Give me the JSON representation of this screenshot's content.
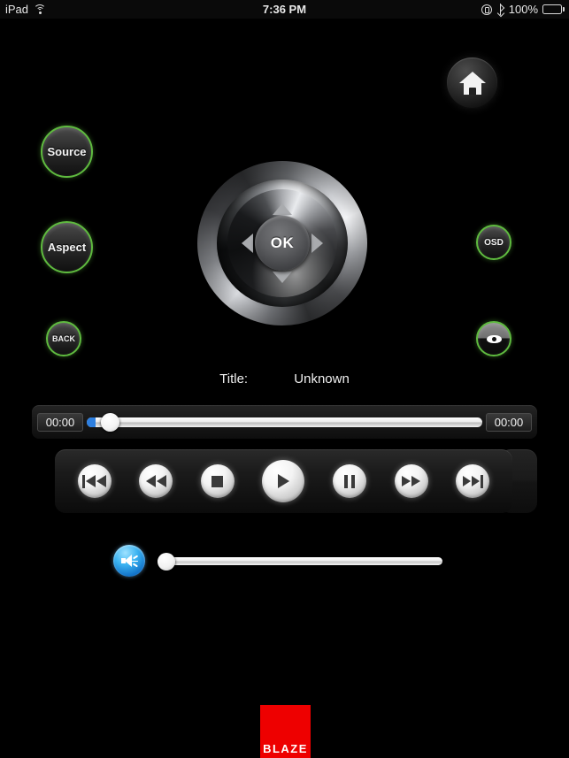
{
  "statusbar": {
    "device": "iPad",
    "wifi_icon": "wifi-icon",
    "time": "7:36 PM",
    "lock_icon": "rotation-lock-icon",
    "bluetooth_icon": "bluetooth-icon",
    "battery_percent": "100%",
    "battery_icon": "battery-icon"
  },
  "nav": {
    "home_icon": "home-icon"
  },
  "controls": {
    "source_label": "Source",
    "aspect_label": "Aspect",
    "back_label": "BACK",
    "osd_label": "OSD",
    "eye_icon": "eye-icon",
    "green_accent": "#5fbb3f"
  },
  "dpad": {
    "ok_label": "OK",
    "up_icon": "arrow-up-icon",
    "down_icon": "arrow-down-icon",
    "left_icon": "arrow-left-icon",
    "right_icon": "arrow-right-icon"
  },
  "media": {
    "title_label": "Title:",
    "title_value": "Unknown",
    "elapsed_time": "00:00",
    "remaining_time": "00:00",
    "seek_position_percent": 1,
    "volume_percent": 0,
    "volume_icon": "speaker-icon",
    "seek_fill_color": "#2d7fe0"
  },
  "transport": {
    "buttons": [
      {
        "name": "skip-back-button",
        "icon": "skip-previous-icon"
      },
      {
        "name": "rewind-button",
        "icon": "rewind-icon"
      },
      {
        "name": "stop-button",
        "icon": "stop-icon"
      },
      {
        "name": "play-button",
        "icon": "play-icon"
      },
      {
        "name": "pause-button",
        "icon": "pause-icon"
      },
      {
        "name": "fast-forward-button",
        "icon": "fast-forward-icon"
      },
      {
        "name": "skip-forward-button",
        "icon": "skip-next-icon"
      }
    ]
  },
  "brand": {
    "name": "BLAZE",
    "color": "#ee0000"
  }
}
